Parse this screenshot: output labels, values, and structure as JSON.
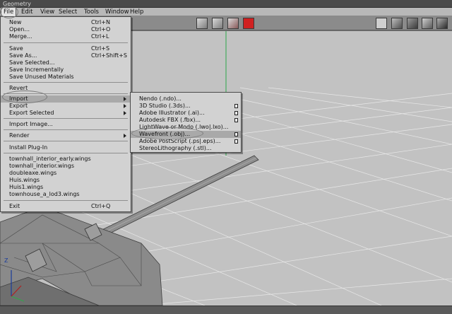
{
  "window": {
    "title": "Geometry"
  },
  "menubar": [
    "File",
    "Edit",
    "View",
    "Select",
    "Tools",
    "Window",
    "Help"
  ],
  "file_menu": {
    "items": [
      {
        "label": "New",
        "shortcut": "Ctrl+N"
      },
      {
        "label": "Open...",
        "shortcut": "Ctrl+O"
      },
      {
        "label": "Merge...",
        "shortcut": "Ctrl+L"
      },
      {
        "label": "Save",
        "shortcut": "Ctrl+S"
      },
      {
        "label": "Save As...",
        "shortcut": "Ctrl+Shift+S"
      },
      {
        "label": "Save Selected...",
        "shortcut": ""
      },
      {
        "label": "Save Incrementally",
        "shortcut": ""
      },
      {
        "label": "Save Unused Materials",
        "shortcut": ""
      },
      {
        "label": "Revert",
        "shortcut": ""
      },
      {
        "label": "Import",
        "shortcut": ""
      },
      {
        "label": "Export",
        "shortcut": ""
      },
      {
        "label": "Export Selected",
        "shortcut": ""
      },
      {
        "label": "Import Image...",
        "shortcut": ""
      },
      {
        "label": "Render",
        "shortcut": ""
      },
      {
        "label": "Install Plug-In",
        "shortcut": ""
      },
      {
        "label": "townhall_interior_early.wings",
        "shortcut": ""
      },
      {
        "label": "townhall_interior.wings",
        "shortcut": ""
      },
      {
        "label": "doubleaxe.wings",
        "shortcut": ""
      },
      {
        "label": "Huis.wings",
        "shortcut": ""
      },
      {
        "label": "Huis1.wings",
        "shortcut": ""
      },
      {
        "label": "townhouse_a_lod3.wings",
        "shortcut": ""
      },
      {
        "label": "Exit",
        "shortcut": "Ctrl+Q"
      }
    ]
  },
  "import_submenu": {
    "items": [
      {
        "label": "Nendo (.ndo)..."
      },
      {
        "label": "3D Studio (.3ds)..."
      },
      {
        "label": "Adobe Illustrator (.ai)..."
      },
      {
        "label": "Autodesk FBX (.fbx)..."
      },
      {
        "label": "LightWave or Modo (.lwo|.lxo)..."
      },
      {
        "label": "Wavefront (.obj)..."
      },
      {
        "label": "Adobe PostScript (.ps|.eps)..."
      },
      {
        "label": "StereoLithography (.stl)..."
      }
    ]
  },
  "viewport": {
    "axis_label": "Z"
  }
}
